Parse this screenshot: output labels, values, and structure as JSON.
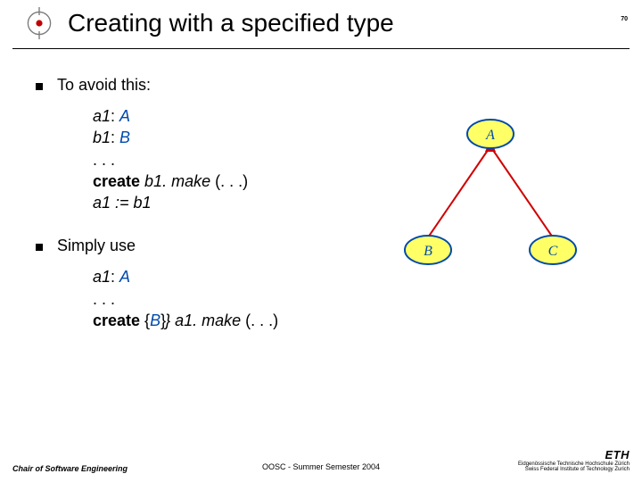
{
  "header": {
    "title": "Creating with a specified type"
  },
  "page_number": "70",
  "bullets": {
    "avoid": "To avoid this:",
    "simply": "Simply use"
  },
  "code1": {
    "l1a": "a1",
    "l1b": ": ",
    "l1c": "A",
    "l2a": "b1",
    "l2b": ": ",
    "l2c": "B",
    "l3": ". . .",
    "l4a": "create",
    "l4b": " b1. make ",
    "l4c": "(. . .)",
    "l5": "a1 := b1"
  },
  "code2": {
    "l1a": "a1",
    "l1b": ": ",
    "l1c": "A",
    "l2": ". . .",
    "l3a": "create",
    "l3b": " {",
    "l3c": "B",
    "l3d": "} a1. make ",
    "l3e": "(. . .)"
  },
  "diagram": {
    "A": "A",
    "B": "B",
    "C": "C"
  },
  "footer": {
    "left": "Chair of Software Engineering",
    "center": "OOSC - Summer Semester 2004",
    "eth": "ETH",
    "eth_sub1": "Eidgenössische Technische Hochschule Zürich",
    "eth_sub2": "Swiss Federal Institute of Technology Zurich"
  }
}
